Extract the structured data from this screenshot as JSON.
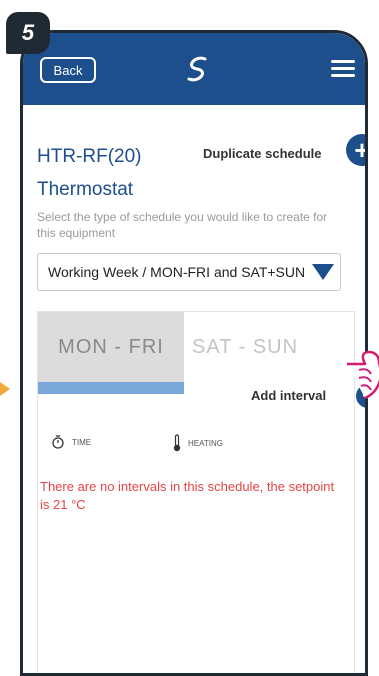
{
  "step": {
    "number": "5"
  },
  "header": {
    "back_label": "Back",
    "logo_icon": "salus-logo-icon",
    "menu_icon": "hamburger-menu-icon"
  },
  "device": {
    "name": "HTR-RF(20)",
    "type": "Thermostat"
  },
  "duplicate": {
    "label": "Duplicate schedule",
    "icon": "plus-icon"
  },
  "schedule_hint": "Select the type of schedule you would like to create for this equipment",
  "schedule_select": {
    "selected": "Working Week / MON-FRI and SAT+SUN"
  },
  "tabs": [
    {
      "label": "MON - FRI",
      "active": true
    },
    {
      "label": "SAT - SUN",
      "active": false
    }
  ],
  "columns": {
    "time": "TIME",
    "heating": "HEATING"
  },
  "empty_message": "There are no intervals in this schedule, the setpoint is 21 °C",
  "add_interval": {
    "label": "Add interval",
    "icon": "plus-icon"
  },
  "colors": {
    "header": "#1d4f8c",
    "accent": "#1d4f8c",
    "tab_bar": "#78a7d8",
    "warning": "#e64545",
    "pointer": "#d61a72"
  }
}
